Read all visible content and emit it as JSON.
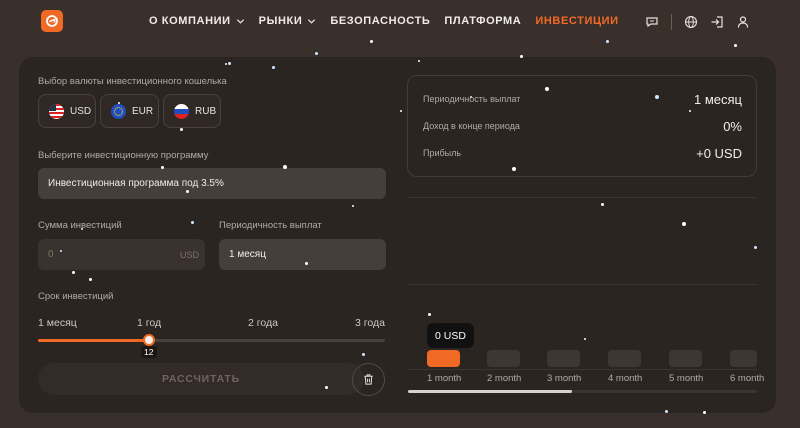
{
  "nav": {
    "items": [
      {
        "label": "О КОМПАНИИ",
        "has_chevron": true,
        "active": false
      },
      {
        "label": "РЫНКИ",
        "has_chevron": true,
        "active": false
      },
      {
        "label": "БЕЗОПАСНОСТЬ",
        "has_chevron": false,
        "active": false
      },
      {
        "label": "ПЛАТФОРМА",
        "has_chevron": false,
        "active": false
      },
      {
        "label": "ИНВЕСТИЦИИ",
        "has_chevron": false,
        "active": true
      }
    ],
    "icons": [
      "chat-icon",
      "globe-icon",
      "login-icon",
      "user-icon"
    ]
  },
  "calculator": {
    "currency_label": "Выбор валюты инвестиционного кошелька",
    "currencies": [
      {
        "code": "USD",
        "icon": "us-flag-icon",
        "selected": true
      },
      {
        "code": "EUR",
        "icon": "eu-flag-icon",
        "selected": false
      },
      {
        "code": "RUB",
        "icon": "ru-flag-icon",
        "selected": false
      }
    ],
    "program_label": "Выберите инвестиционную программу",
    "program_value": "Инвестиционная программа под 3.5%",
    "amount_label": "Сумма инвестиций",
    "amount_placeholder": "0",
    "amount_suffix": "USD",
    "payout_label": "Периодичность выплат",
    "payout_value": "1 месяц",
    "term_label": "Срок инвестиций",
    "term_ticks": [
      "1 месяц",
      "1 год",
      "2 года",
      "3 года"
    ],
    "term_value": "12",
    "term_fraction": 0.32,
    "calculate_label": "РАССЧИТАТЬ"
  },
  "summary": {
    "rows": [
      {
        "key": "Периодичность выплат",
        "value": "1 месяц"
      },
      {
        "key": "Доход в конце периода",
        "value": "0%"
      },
      {
        "key": "Прибыль",
        "value": "+0 USD"
      }
    ]
  },
  "chart": {
    "tooltip": "0 USD",
    "months": [
      "1 month",
      "2 month",
      "3 month",
      "4 month",
      "5 month",
      "6 month"
    ],
    "active_index": 0,
    "scroll_fraction": 0.47
  },
  "colors": {
    "accent": "#f06a26",
    "background": "#3a302b",
    "panel": "#2b2522"
  }
}
